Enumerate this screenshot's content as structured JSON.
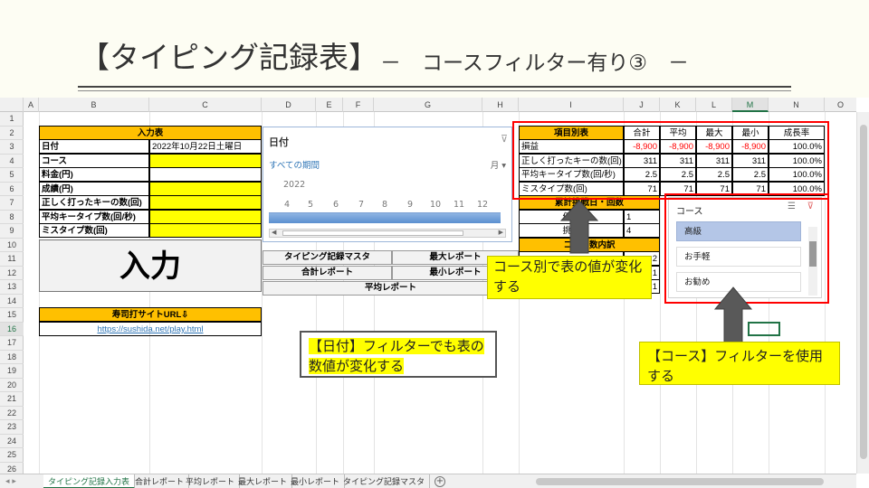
{
  "slide": {
    "title": "【タイピング記録表】",
    "subtitle": "－　コースフィルター有り③　－"
  },
  "columns": [
    "A",
    "B",
    "C",
    "D",
    "E",
    "F",
    "G",
    "H",
    "I",
    "J",
    "K",
    "L",
    "M",
    "N",
    "O"
  ],
  "rows": [
    "1",
    "2",
    "3",
    "4",
    "5",
    "6",
    "7",
    "8",
    "9",
    "10",
    "11",
    "12",
    "13",
    "14",
    "15",
    "16",
    "17",
    "18",
    "19",
    "20",
    "21",
    "22",
    "23",
    "24",
    "25",
    "26"
  ],
  "input_table": {
    "header": "入力表",
    "rows": [
      {
        "label": "日付",
        "value": "2022年10月22日土曜日"
      },
      {
        "label": "コース",
        "value": ""
      },
      {
        "label": "料金(円)",
        "value": ""
      },
      {
        "label": "成績(円)",
        "value": ""
      },
      {
        "label": "正しく打ったキーの数(回)",
        "value": ""
      },
      {
        "label": "平均キータイプ数(回/秒)",
        "value": ""
      },
      {
        "label": "ミスタイプ数(回)",
        "value": ""
      }
    ],
    "button": "入力"
  },
  "url_box": {
    "header": "寿司打サイトURL⇩",
    "url": "https://sushida.net/play.html"
  },
  "nav_buttons": {
    "master": "タイピング記録マスタ",
    "max_report": "最大レポート",
    "total_report": "合計レポート",
    "min_report": "最小レポート",
    "avg_report": "平均レポート"
  },
  "timeline": {
    "title": "日付",
    "period": "すべての期間",
    "unit": "月 ▾",
    "year": "2022",
    "months": [
      "4",
      "5",
      "6",
      "7",
      "8",
      "9",
      "10",
      "11",
      "12"
    ]
  },
  "stats": {
    "headers": [
      "項目別表",
      "合計",
      "平均",
      "最大",
      "最小",
      "成長率"
    ],
    "rows": [
      {
        "label": "損益",
        "values": [
          "-8,900",
          "-8,900",
          "-8,900",
          "-8,900",
          "100.0%"
        ]
      },
      {
        "label": "正しく打ったキーの数(回)",
        "values": [
          "311",
          "311",
          "311",
          "311",
          "100.0%"
        ]
      },
      {
        "label": "平均キータイプ数(回/秒)",
        "values": [
          "2.5",
          "2.5",
          "2.5",
          "2.5",
          "100.0%"
        ]
      },
      {
        "label": "ミスタイプ数(回)",
        "values": [
          "71",
          "71",
          "71",
          "71",
          "100.0%"
        ]
      }
    ],
    "sub1_header": "累計挑戦日・回数",
    "sub1_rows": [
      {
        "label": "何日",
        "value": "1"
      },
      {
        "label": "挑戦",
        "value": "4"
      }
    ],
    "sub2_header": "コ　回数内訳",
    "sub2_vals": [
      "2",
      "1",
      "1"
    ]
  },
  "slicer": {
    "title": "コース",
    "items": [
      "高級",
      "お手軽",
      "お勧め"
    ]
  },
  "callouts": {
    "course_change": "コース別で表の値が変化する",
    "date_filter": "【日付】フィルターでも表の数値が変化する",
    "use_filter": "【コース】フィルターを使用する"
  },
  "tabs": [
    "タイピング記録入力表",
    "合計レポート",
    "平均レポート",
    "最大レポート",
    "最小レポート",
    "タイピング記録マスタ"
  ],
  "colors": {
    "header_orange": "#ffc000",
    "input_yellow": "#ffff00",
    "negative_red": "#ff0000",
    "frame_red": "#ff0000",
    "excel_green": "#217346"
  }
}
